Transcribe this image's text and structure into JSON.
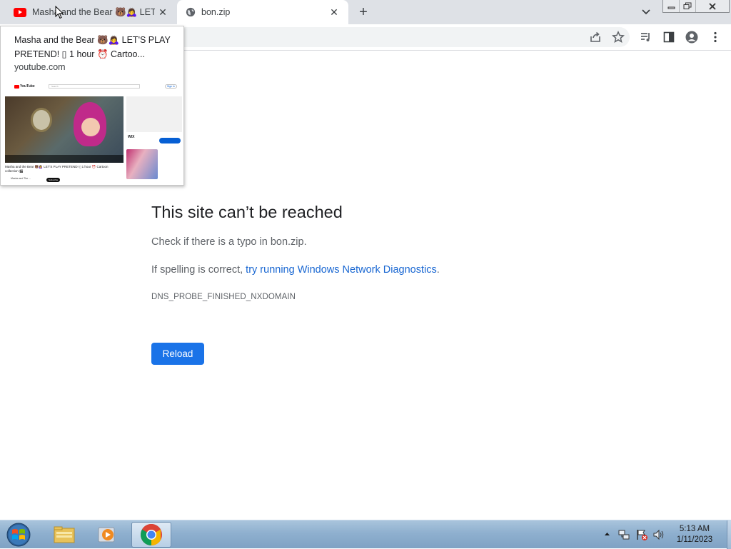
{
  "tabs": [
    {
      "title": "Masha and the Bear 🐻🙇‍♀️ LET'S",
      "favicon": "youtube-icon",
      "active": false
    },
    {
      "title": "bon.zip",
      "favicon": "globe-icon",
      "active": true
    }
  ],
  "tab_close_glyph": "✕",
  "new_tab_glyph": "+",
  "hover_card": {
    "title": "Masha and the Bear 🐻🙇‍♀️ LET'S PLAY PRETEND! ▯ 1 hour ⏰ Cartoo...",
    "domain": "youtube.com",
    "thumbnail": {
      "logo": "YouTube",
      "search_placeholder": "Search",
      "signin": "Sign in",
      "video_title": "Masha and the Bear 🐻🙇‍♀️ LET'S PLAY PRETEND! ▯ 1 hour ⏰ Cartoon collection 🎬",
      "channel": "Masha and The ...",
      "subscribe": "Subscribe",
      "ad_brand": "WIX"
    }
  },
  "error": {
    "title": "This site can’t be reached",
    "line1": "Check if there is a typo in bon.zip.",
    "line2_prefix": "If spelling is correct, ",
    "line2_link": "try running Windows Network Diagnostics",
    "line2_suffix": ".",
    "code": "DNS_PROBE_FINISHED_NXDOMAIN",
    "reload_label": "Reload"
  },
  "taskbar": {
    "clock_time": "5:13 AM",
    "clock_date": "1/11/2023"
  },
  "colors": {
    "accent": "#1a73e8",
    "link": "#1967d2",
    "youtube_red": "#ff0000",
    "tabstrip": "#dee1e6"
  }
}
